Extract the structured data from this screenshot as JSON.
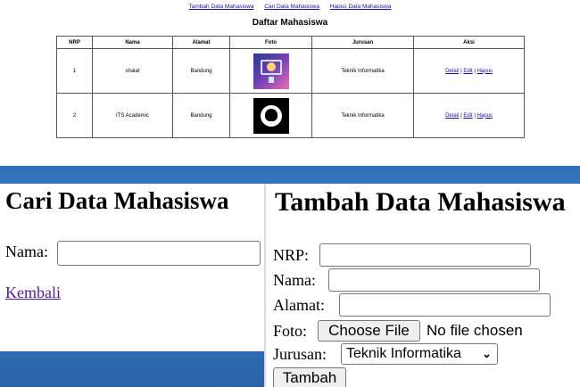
{
  "top": {
    "nav": [
      "Tambah Data Mahasiswa",
      "Cari Data Mahasiswa",
      "Hapus Data Mahasiswa"
    ],
    "title": "Daftar Mahasiswa",
    "table": {
      "headers": [
        "NRP",
        "Nama",
        "Alamat",
        "Foto",
        "Jurusan",
        "Aksi"
      ],
      "rows": [
        {
          "nrp": "1",
          "nama": "shalat",
          "alamat": "Bandung",
          "foto": "monitor-image",
          "jurusan": "Teknik Informatika"
        },
        {
          "nrp": "2",
          "nama": "ITS Academic",
          "alamat": "Bandung",
          "foto": "github-logo-image",
          "jurusan": "Teknik Informatika"
        }
      ],
      "actions": {
        "detail": "Detail",
        "sep": " | ",
        "edit": "Edit",
        "hapus": "Hapus"
      }
    }
  },
  "cari": {
    "title": "Cari Data Mahasiswa",
    "nama_label": "Nama:",
    "nama_value": "",
    "back_link": "Kembali"
  },
  "tambah": {
    "title": "Tambah Data Mahasiswa",
    "nrp_label": "NRP:",
    "nama_label": "Nama:",
    "alamat_label": "Alamat:",
    "foto_label": "Foto:",
    "choose_file": "Choose File",
    "no_file": "No file chosen",
    "jurusan_label": "Jurusan:",
    "jurusan_selected": "Teknik Informatika",
    "submit": "Tambah"
  }
}
